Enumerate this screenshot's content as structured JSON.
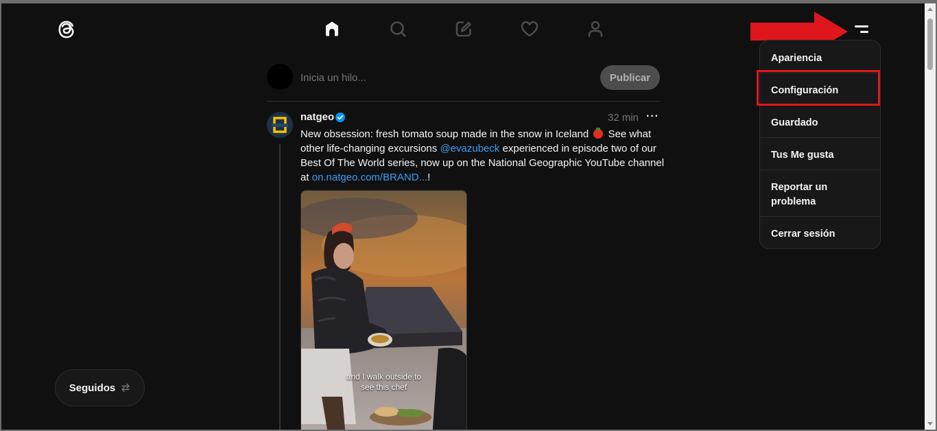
{
  "nav": {
    "logo": "threads-logo-icon",
    "tabs": [
      {
        "name": "home-icon",
        "active": true
      },
      {
        "name": "search-icon",
        "active": false
      },
      {
        "name": "compose-icon",
        "active": false
      },
      {
        "name": "heart-icon",
        "active": false
      },
      {
        "name": "profile-icon",
        "active": false
      }
    ],
    "menu_icon": "menu-icon"
  },
  "menu": {
    "items": [
      {
        "label": "Apariencia"
      },
      {
        "label": "Configuración",
        "highlighted": true
      },
      {
        "label": "Guardado"
      },
      {
        "label": "Tus Me gusta"
      },
      {
        "label": "Reportar un problema"
      },
      {
        "label": "Cerrar sesión"
      }
    ]
  },
  "composer": {
    "placeholder": "Inicia un hilo...",
    "publish_label": "Publicar"
  },
  "post": {
    "username": "natgeo",
    "verified": true,
    "time": "32 min",
    "more_label": "···",
    "text_1": "New obsession: fresh tomato soup made in the snow in Iceland",
    "text_2": " See what other life-changing excursions ",
    "mention": "@evazubeck",
    "text_3": " experienced in episode two of our Best Of The World series, now up on the National Geographic YouTube channel at ",
    "link": "on.natgeo.com/BRAND...",
    "text_4": "!",
    "video_caption_1": "and I walk outside to",
    "video_caption_2": "see this chef"
  },
  "feed_switch": {
    "label": "Seguidos",
    "icon": "swap-arrows-icon"
  },
  "colors": {
    "background": "#101010",
    "text": "#f3f5f7",
    "link": "#3b9ff5",
    "highlight_box": "#e0161d",
    "annotation_arrow": "#e0161d"
  }
}
